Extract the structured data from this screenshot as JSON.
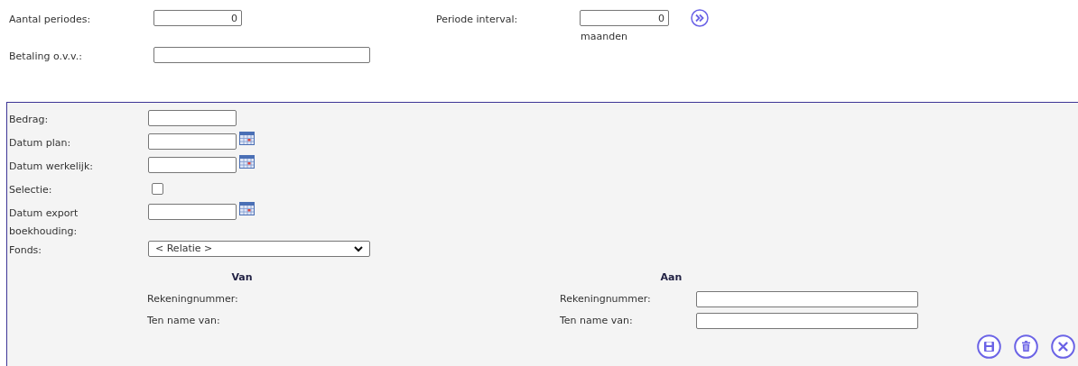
{
  "aantal_periodes": {
    "label": "Aantal periodes:",
    "value": "0"
  },
  "periode_interval": {
    "label": "Periode interval:",
    "value": "0",
    "unit": "maanden"
  },
  "betaling": {
    "label": "Betaling o.v.v.:"
  },
  "panel": {
    "fields": [
      {
        "kind": "text",
        "label": "Bedrag:"
      },
      {
        "kind": "date",
        "label": "Datum plan:"
      },
      {
        "kind": "date",
        "label": "Datum werkelijk:"
      },
      {
        "kind": "checkbox",
        "label": "Selectie:",
        "checked": false
      },
      {
        "kind": "date",
        "label": "Datum export boekhouding:"
      },
      {
        "kind": "select",
        "label": "Fonds:",
        "value": "< Relatie >"
      }
    ],
    "van": {
      "heading": "Van",
      "rows": [
        {
          "label": "Rekeningnummer:"
        },
        {
          "label": "Ten name van:"
        }
      ]
    },
    "aan": {
      "heading": "Aan",
      "rows": [
        {
          "label": "Rekeningnummer:"
        },
        {
          "label": "Ten name van:"
        }
      ]
    },
    "actions": [
      {
        "kind": "save"
      },
      {
        "kind": "delete"
      },
      {
        "kind": "close"
      }
    ]
  }
}
